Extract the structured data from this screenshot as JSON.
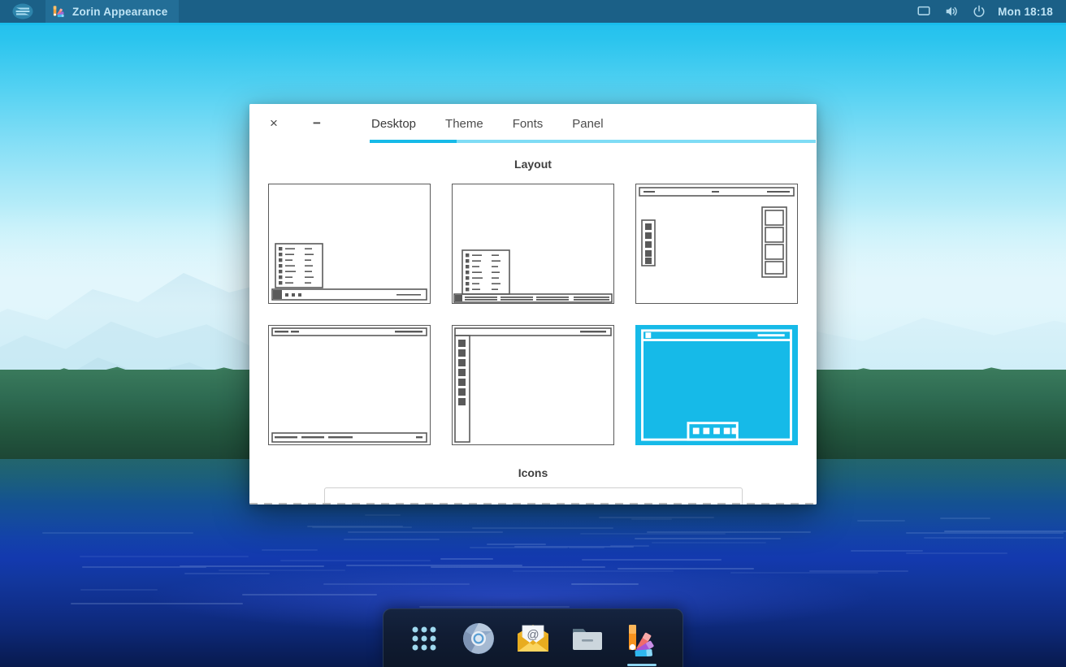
{
  "panel": {
    "zorin_logo": "zorin-logo-icon",
    "app_icon": "zorin-appearance-icon",
    "app_title": "Zorin Appearance",
    "tray": [
      {
        "name": "display-icon",
        "label": "Display"
      },
      {
        "name": "volume-icon",
        "label": "Volume"
      },
      {
        "name": "power-icon",
        "label": "Power"
      }
    ],
    "clock": "Mon 18:18"
  },
  "window": {
    "controls": {
      "close": "×",
      "minimize": "−"
    },
    "tabs": [
      {
        "label": "Desktop",
        "active": true
      },
      {
        "label": "Theme",
        "active": false
      },
      {
        "label": "Fonts",
        "active": false
      },
      {
        "label": "Panel",
        "active": false
      }
    ],
    "layout_section": {
      "title": "Layout",
      "options": [
        {
          "name": "layout-windows-classic",
          "style": "menu-bottom-left",
          "selected": false
        },
        {
          "name": "layout-windows-modern",
          "style": "menu-bottom-full",
          "selected": false
        },
        {
          "name": "layout-macos-like",
          "style": "topbar-left-dock-right-panel",
          "selected": false
        },
        {
          "name": "layout-gnome-classic",
          "style": "topbar-bottom-taskbar",
          "selected": false
        },
        {
          "name": "layout-unity-like",
          "style": "topbar-left-sidebar",
          "selected": false
        },
        {
          "name": "layout-touch",
          "style": "topbar-bottom-center-dock",
          "selected": true
        }
      ]
    },
    "icons_section": {
      "title": "Icons"
    }
  },
  "dock": {
    "items": [
      {
        "name": "show-applications-icon",
        "label": "Show Applications"
      },
      {
        "name": "chromium-browser-icon",
        "label": "Chromium Web Browser"
      },
      {
        "name": "mail-client-icon",
        "label": "Mail"
      },
      {
        "name": "file-manager-icon",
        "label": "Files"
      },
      {
        "name": "zorin-appearance-icon",
        "label": "Zorin Appearance",
        "running": true
      }
    ]
  },
  "colors": {
    "accent_cyan": "#16bae8",
    "accent_cyan_light": "#7fdcf5",
    "panel_bg": "#1b6087",
    "panel_text": "#bfe4f5",
    "dock_bg": "#101c33",
    "thumb_stroke": "#5a5a5a"
  }
}
